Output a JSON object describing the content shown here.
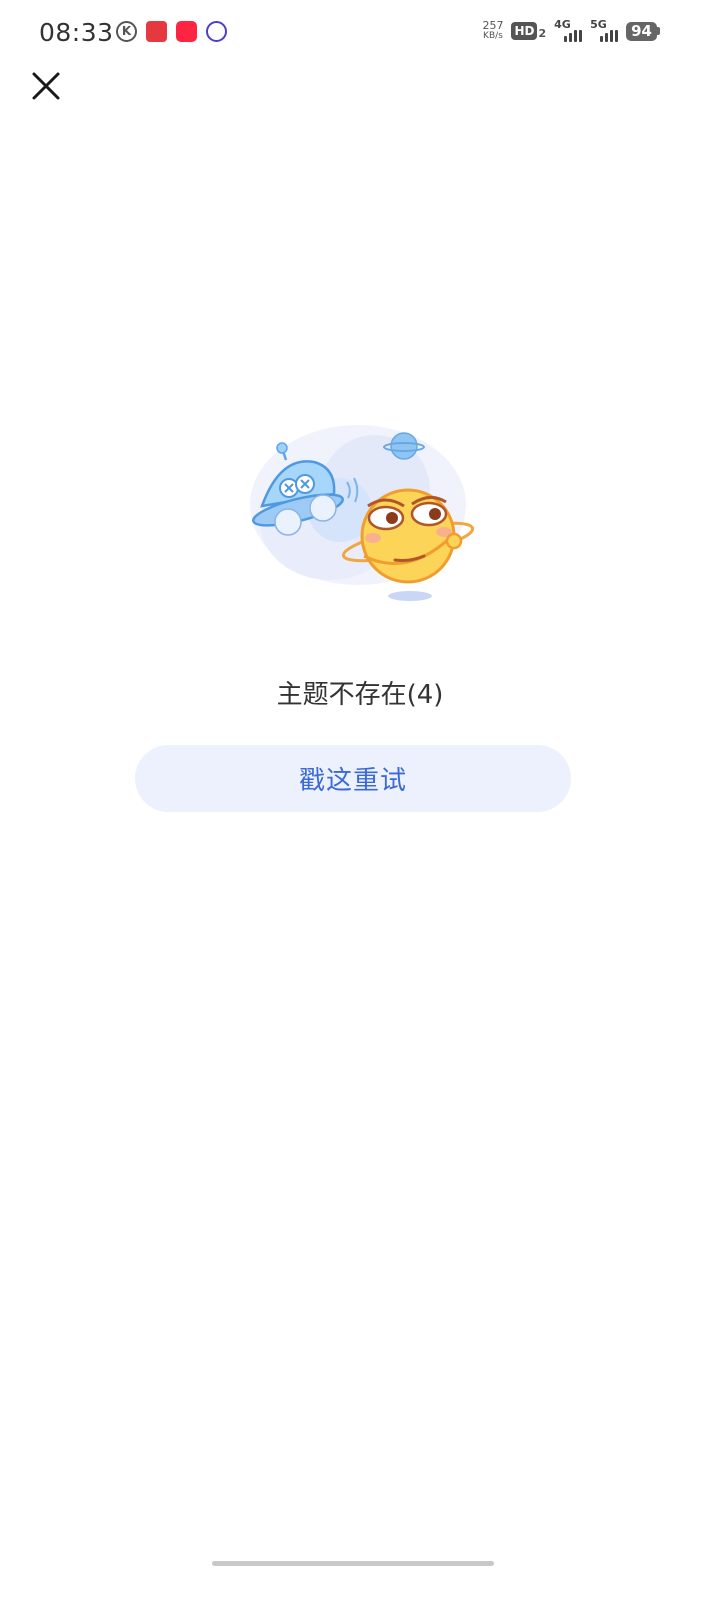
{
  "status_bar": {
    "time": "08:33",
    "net_speed_value": "257",
    "net_speed_unit": "KB/s",
    "hd_label": "HD",
    "hd_sub": "2",
    "signal_1_label": "4G",
    "signal_2_label": "5G",
    "battery_level": "94",
    "notification_icons": [
      "k-icon",
      "taobao-icon",
      "xiaohongshu-icon",
      "tieba-icon"
    ]
  },
  "toolbar": {
    "close_icon": "close-icon"
  },
  "error": {
    "message": "主题不存在(4)",
    "retry_label": "戳这重试",
    "illustration": "ufo-and-planet-emoji-illustration"
  },
  "colors": {
    "accent": "#3b6ad6",
    "button_bg": "#edf1fd",
    "text": "#333333",
    "background": "#ffffff"
  }
}
